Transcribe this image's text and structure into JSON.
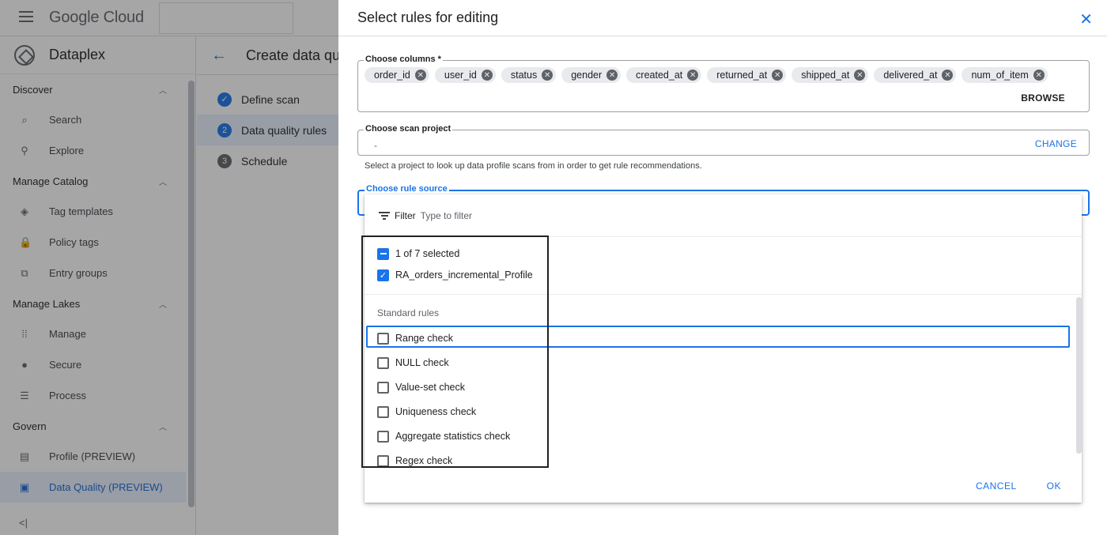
{
  "header": {
    "logo_text": "Google Cloud",
    "product": "Dataplex"
  },
  "sidebar": {
    "sections": [
      {
        "label": "Discover",
        "items": [
          {
            "label": "Search",
            "icon": "search-icon"
          },
          {
            "label": "Explore",
            "icon": "explore-icon"
          }
        ]
      },
      {
        "label": "Manage Catalog",
        "items": [
          {
            "label": "Tag templates",
            "icon": "tag-icon"
          },
          {
            "label": "Policy tags",
            "icon": "lock-icon"
          },
          {
            "label": "Entry groups",
            "icon": "entry-groups-icon"
          }
        ]
      },
      {
        "label": "Manage Lakes",
        "items": [
          {
            "label": "Manage",
            "icon": "grid-icon"
          },
          {
            "label": "Secure",
            "icon": "person-icon"
          },
          {
            "label": "Process",
            "icon": "list-icon"
          }
        ]
      },
      {
        "label": "Govern",
        "items": [
          {
            "label": "Profile (PREVIEW)",
            "icon": "profile-icon"
          },
          {
            "label": "Data Quality (PREVIEW)",
            "icon": "data-quality-icon",
            "active": true
          }
        ]
      }
    ],
    "collapse_glyph": "<|"
  },
  "main": {
    "title": "Create data qu",
    "steps": [
      {
        "label": "Define scan",
        "number": "✓",
        "state": "done"
      },
      {
        "label": "Data quality rules",
        "number": "2",
        "state": "active"
      },
      {
        "label": "Schedule",
        "number": "3",
        "state": "pending"
      }
    ]
  },
  "panel": {
    "title": "Select rules for editing",
    "columns_label": "Choose columns *",
    "columns": [
      "order_id",
      "user_id",
      "status",
      "gender",
      "created_at",
      "returned_at",
      "shipped_at",
      "delivered_at",
      "num_of_item"
    ],
    "browse_label": "BROWSE",
    "scan_project_label": "Choose scan project",
    "scan_project_value": "-",
    "change_label": "CHANGE",
    "scan_project_helper": "Select a project to look up data profile scans from in order to get rule recommendations.",
    "rule_source_label": "Choose rule source"
  },
  "dropdown": {
    "filter_label": "Filter",
    "filter_placeholder": "Type to filter",
    "select_all_label": "1 of 7 selected",
    "profile_option": "RA_orders_incremental_Profile",
    "group_label": "Standard rules",
    "rules": [
      "Range check",
      "NULL check",
      "Value-set check",
      "Uniqueness check",
      "Aggregate statistics check",
      "Regex check"
    ],
    "cancel_label": "CANCEL",
    "ok_label": "OK"
  },
  "colors": {
    "accent": "#1a73e8",
    "scrim": "#202124"
  }
}
